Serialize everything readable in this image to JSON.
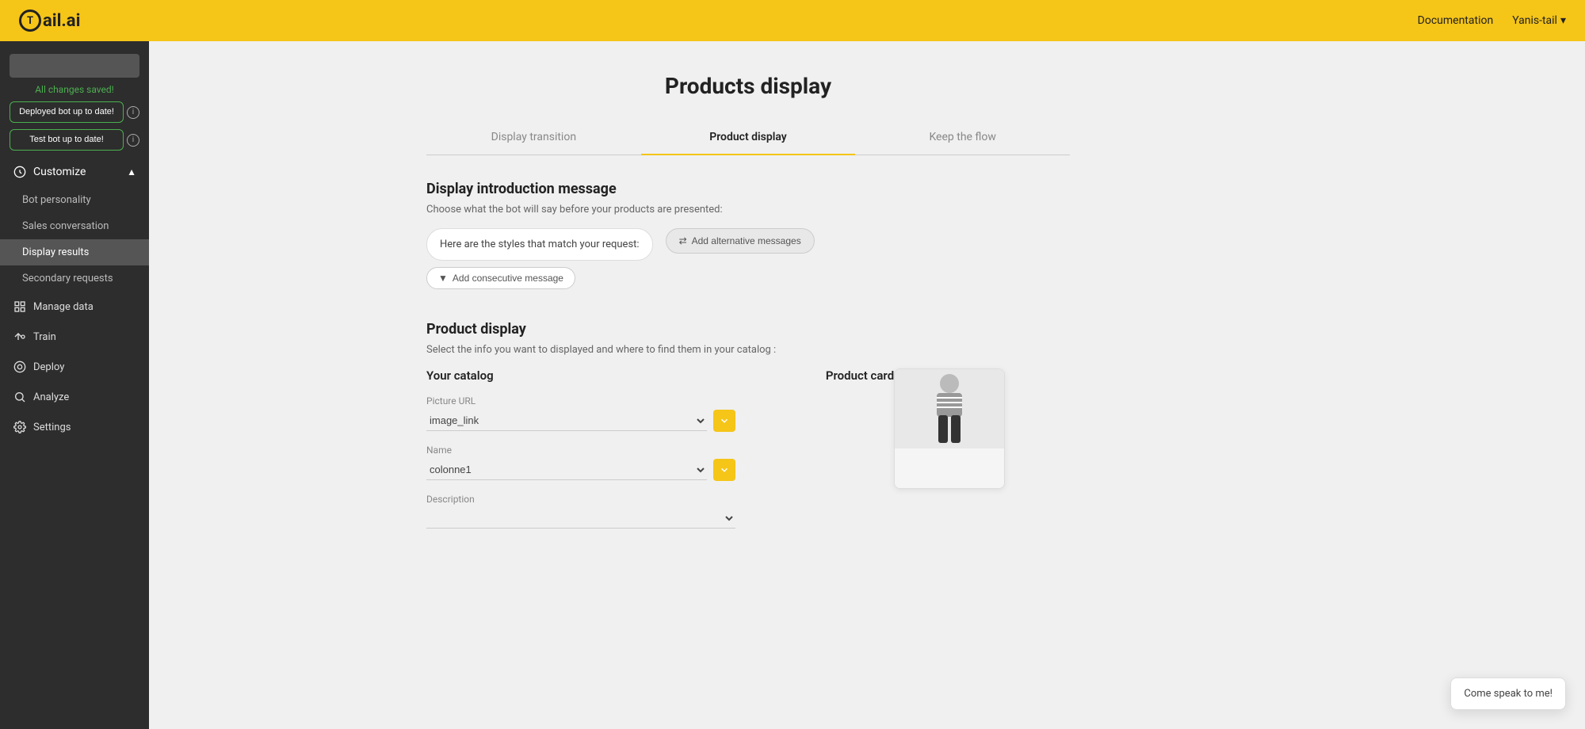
{
  "app": {
    "name": "Tail.ai",
    "logo_letter": "T"
  },
  "top_nav": {
    "documentation_label": "Documentation",
    "user_label": "Yanis-tail"
  },
  "sidebar": {
    "search_placeholder": "",
    "saved_label": "All changes saved!",
    "deploy_btn_label": "Deployed bot up to date!",
    "test_btn_label": "Test bot up to date!",
    "customize_label": "Customize",
    "sub_items": [
      {
        "id": "bot-personality",
        "label": "Bot personality"
      },
      {
        "id": "sales-conversation",
        "label": "Sales conversation"
      },
      {
        "id": "display-results",
        "label": "Display results",
        "active": true
      },
      {
        "id": "secondary-requests",
        "label": "Secondary requests"
      }
    ],
    "nav_items": [
      {
        "id": "manage-data",
        "label": "Manage data",
        "icon": "grid"
      },
      {
        "id": "train",
        "label": "Train",
        "icon": "train"
      },
      {
        "id": "deploy",
        "label": "Deploy",
        "icon": "deploy"
      },
      {
        "id": "analyze",
        "label": "Analyze",
        "icon": "analyze"
      },
      {
        "id": "settings",
        "label": "Settings",
        "icon": "settings"
      }
    ]
  },
  "page": {
    "title": "Products display"
  },
  "tabs": [
    {
      "id": "display-transition",
      "label": "Display transition",
      "active": false
    },
    {
      "id": "product-display",
      "label": "Product display",
      "active": true
    },
    {
      "id": "keep-the-flow",
      "label": "Keep the flow",
      "active": false
    }
  ],
  "intro_section": {
    "title": "Display introduction message",
    "subtitle": "Choose what the bot will say before your products are presented:",
    "message_text": "Here are the styles that match your request:",
    "add_alternative_label": "Add alternative messages",
    "add_consecutive_label": "Add consecutive message"
  },
  "product_display_section": {
    "title": "Product display",
    "subtitle": "Select the info you want to displayed and where to find them in your catalog :",
    "your_catalog_label": "Your catalog",
    "product_card_label": "Product card",
    "fields": [
      {
        "id": "picture-url",
        "label": "Picture URL",
        "value": "image_link"
      },
      {
        "id": "name",
        "label": "Name",
        "value": "colonne1"
      },
      {
        "id": "description",
        "label": "Description",
        "value": ""
      }
    ]
  },
  "chat_widget": {
    "text": "Come speak to me!"
  }
}
